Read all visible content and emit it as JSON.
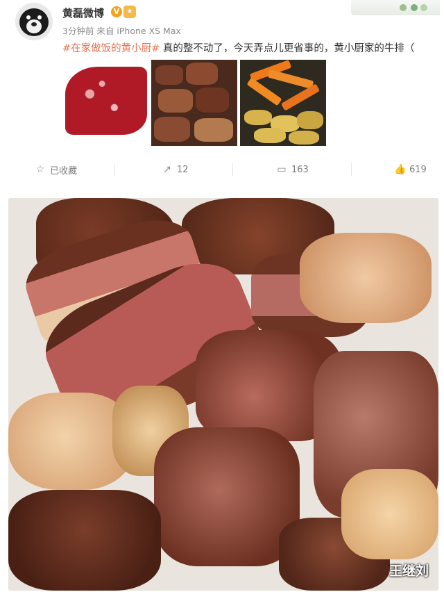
{
  "post": {
    "author": "黄磊微博",
    "meta": "3分钟前 来自 iPhone XS Max",
    "hashtag": "#在家做饭的黄小厨#",
    "body_text": " 真的整不动了，今天弄点儿更省事的，黄小厨家的牛排（"
  },
  "badges": {
    "verified": "V",
    "level": "㊊"
  },
  "actions": {
    "favorite": {
      "label": "已收藏",
      "icon": "star-icon"
    },
    "repost": {
      "count": "12",
      "icon": "repost-icon"
    },
    "comment": {
      "count": "163",
      "icon": "comment-icon"
    },
    "like": {
      "count": "619",
      "icon": "thumbs-up-icon"
    }
  },
  "thumbnails": [
    {
      "subject": "raw-wagyu-steak"
    },
    {
      "subject": "seared-beef-cubes"
    },
    {
      "subject": "carrots-and-potatoes"
    }
  ],
  "photo": {
    "watermark": "王继刘"
  },
  "colors": {
    "hashtag": "#eb7350",
    "text": "#333333",
    "meta": "#8a8a8a"
  }
}
